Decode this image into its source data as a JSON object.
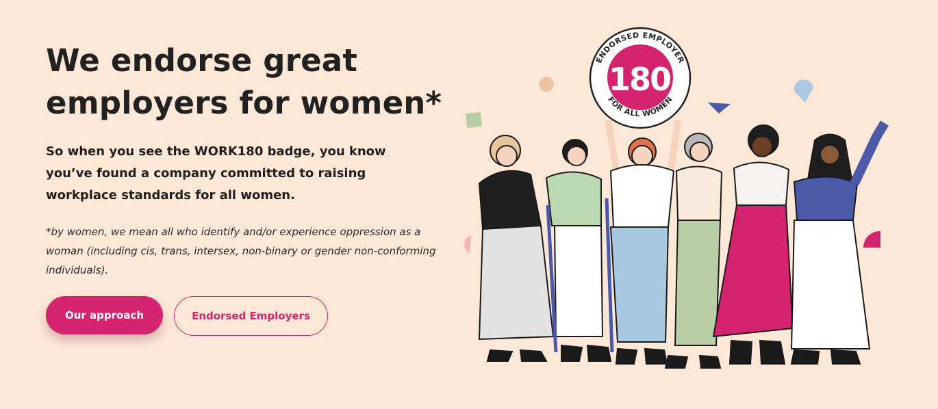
{
  "hero": {
    "headline_line1": "We endorse great",
    "headline_line2": "employers for women*",
    "lead": "So when you see the WORK180 badge, you know you’ve found a company committed to raising workplace standards for all women.",
    "footnote": "*by women, we mean all who identify and/or experience oppression as a woman (including cis, trans, intersex, non-binary or gender non-conforming individuals)."
  },
  "buttons": {
    "primary_label": "Our approach",
    "secondary_label": "Endorsed Employers"
  },
  "badge": {
    "number": "180",
    "top_text": "ENDORSED EMPLOYER",
    "bottom_text": "FOR ALL WOMEN"
  },
  "colors": {
    "background": "#FDE7D6",
    "accent": "#D42470",
    "text": "#212121"
  }
}
